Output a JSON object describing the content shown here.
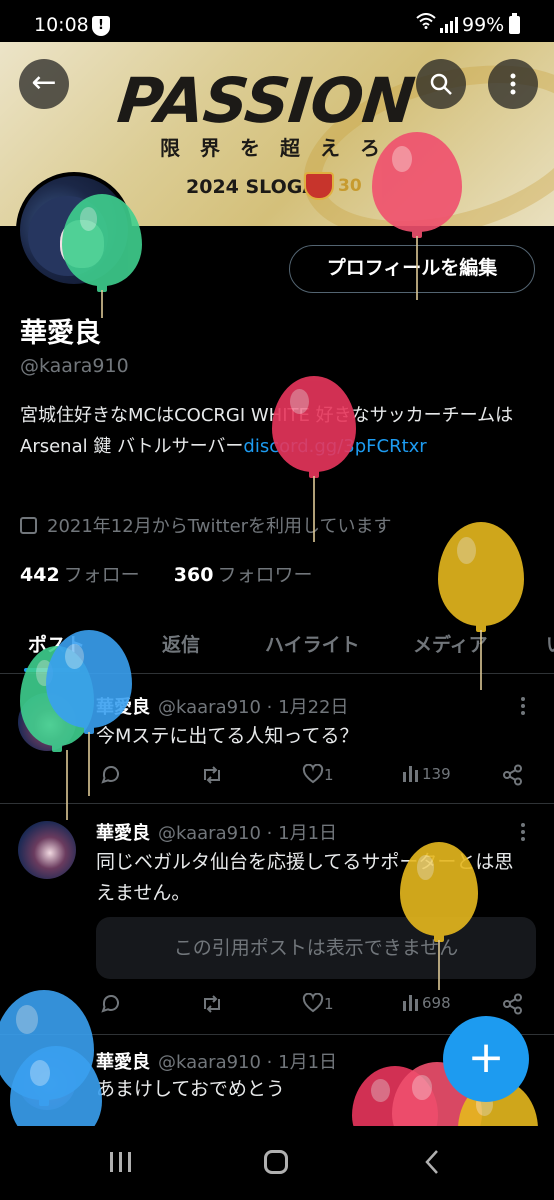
{
  "status_bar": {
    "time": "10:08",
    "battery": "99%"
  },
  "banner": {
    "headline": "PASSION",
    "subline": "限界を超えろ",
    "slogan": "2024 SLOGAN",
    "anniversary": "30"
  },
  "header": {
    "back_icon": "arrow-left-icon",
    "search_icon": "search-icon",
    "more_icon": "more-vertical-icon"
  },
  "profile": {
    "edit_button": "プロフィールを編集",
    "display_name": "華愛良",
    "handle": "@kaara910",
    "bio_text": "宮城住好きなMCはCOCRGI WHITE 好きなサッカーチームはArsenal 鍵 バトルサーバー",
    "bio_link": "discord.gg/3pFCRtxr",
    "joined": "2021年12月からTwitterを利用しています",
    "following_count": "442",
    "following_label": "フォロー",
    "followers_count": "360",
    "followers_label": "フォロワー"
  },
  "tabs": [
    {
      "label": "ポスト",
      "active": true
    },
    {
      "label": "返信",
      "active": false
    },
    {
      "label": "ハイライト",
      "active": false
    },
    {
      "label": "メディア",
      "active": false
    },
    {
      "label": "い",
      "active": false
    }
  ],
  "posts": [
    {
      "name": "華愛良",
      "meta": "@kaara910 · 1月22日",
      "text": "今Mステに出てる人知ってる？",
      "likes": "1",
      "views": "139"
    },
    {
      "name": "華愛良",
      "meta": "@kaara910 · 1月1日",
      "text": "同じベガルタ仙台を応援してるサポーターとは思えません。",
      "quote": "この引用ポストは表示できません",
      "likes": "1",
      "views": "698"
    },
    {
      "name": "華愛良",
      "meta": "@kaara910 · 1月1日",
      "text": "あまけしておでめとう"
    }
  ],
  "fab": {
    "label": "+"
  },
  "colors": {
    "accent": "#1d9bf0",
    "background": "#000000",
    "muted": "#71767b"
  }
}
